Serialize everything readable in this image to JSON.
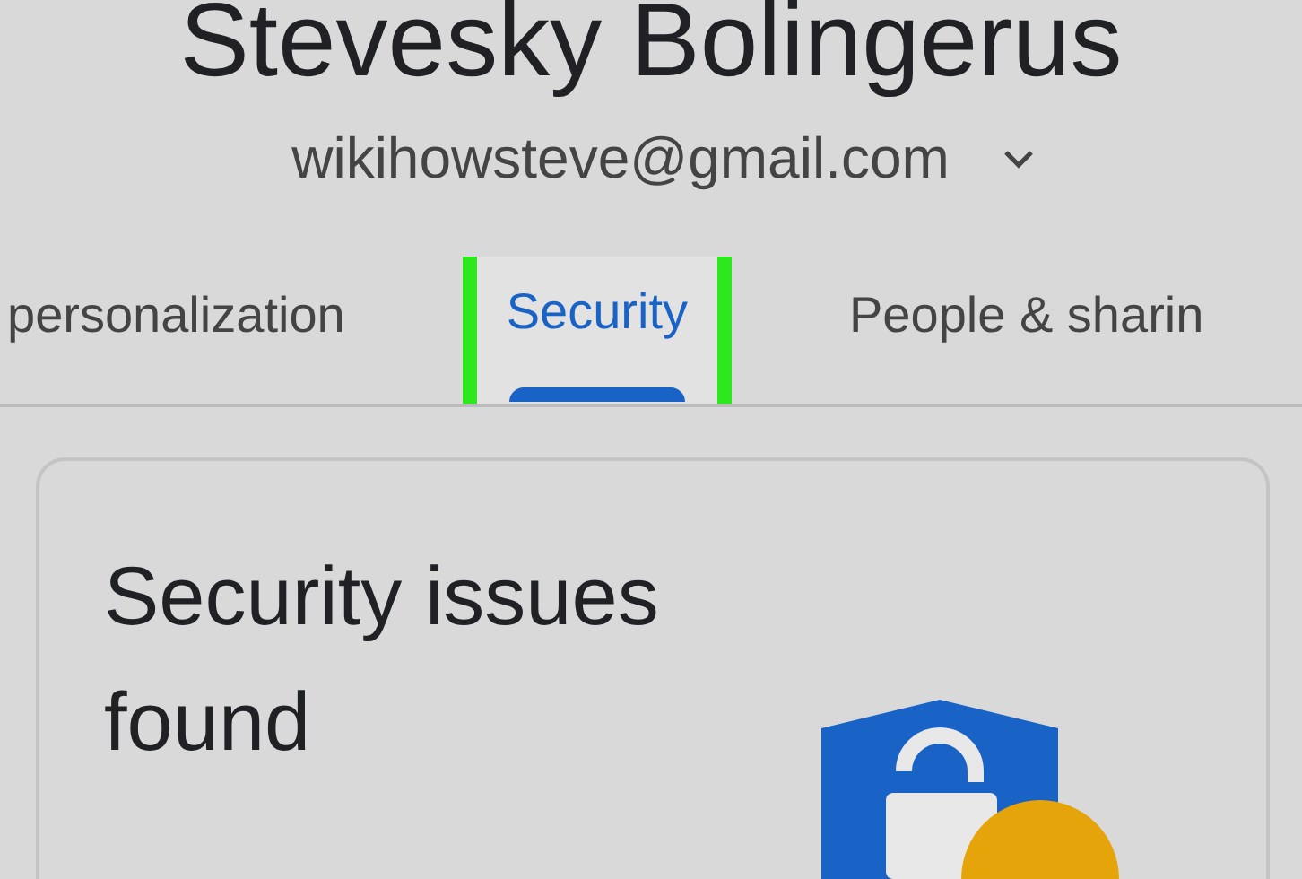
{
  "account": {
    "name": "Stevesky Bolingerus",
    "email": "wikihowsteve@gmail.com"
  },
  "tabs": [
    {
      "label": "personalization",
      "selected": false
    },
    {
      "label": "Security",
      "selected": true,
      "highlighted": true
    },
    {
      "label": "People & sharin",
      "selected": false
    }
  ],
  "card": {
    "title": "Security issues found"
  }
}
